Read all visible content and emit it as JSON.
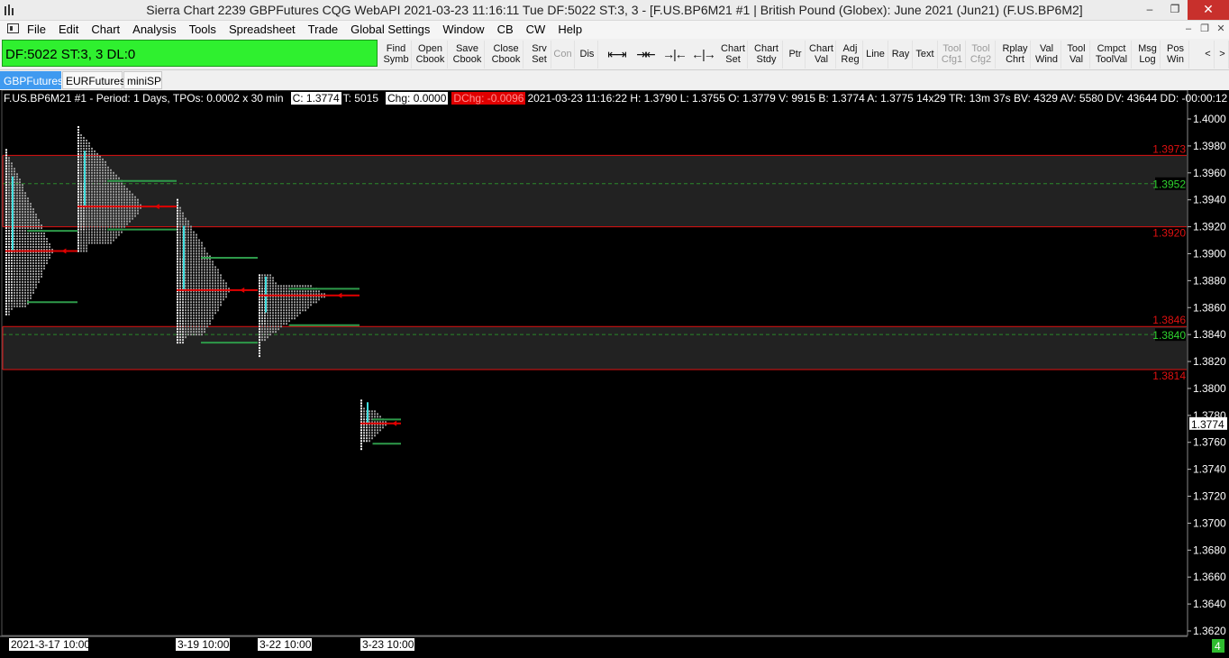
{
  "window": {
    "title": "Sierra Chart 2239 GBPFutures  CQG WebAPI 2021-03-23  11:16:11 Tue  DF:5022  ST:3, 3 - [F.US.BP6M21  #1 | British Pound (Globex): June 2021 (Jun21) (F.US.BP6M2]",
    "minimize": "–",
    "restore": "❐",
    "close": "✕"
  },
  "menu": {
    "items": [
      "File",
      "Edit",
      "Chart",
      "Analysis",
      "Tools",
      "Spreadsheet",
      "Trade",
      "Global Settings",
      "Window",
      "CB",
      "CW",
      "Help"
    ],
    "mdi_min": "–",
    "mdi_restore": "❐",
    "mdi_close": "✕"
  },
  "toolbar": {
    "status": "DF:5022  ST:3, 3  DL:0",
    "buttons": [
      {
        "l1": "Find",
        "l2": "Symb",
        "enabled": true
      },
      {
        "l1": "Open",
        "l2": "Cbook",
        "enabled": true
      },
      {
        "l1": "Save",
        "l2": "Cbook",
        "enabled": true
      },
      {
        "l1": "Close",
        "l2": "Cbook",
        "enabled": true
      },
      {
        "l1": "Srv",
        "l2": "Set",
        "enabled": true
      },
      {
        "l1": "Con",
        "l2": "",
        "enabled": false
      },
      {
        "l1": "Dis",
        "l2": "",
        "enabled": true
      }
    ],
    "icons": [
      "⇤⇥",
      "⇥⇤",
      "→|←",
      "←|→"
    ],
    "buttons2": [
      {
        "l1": "Chart",
        "l2": "Set",
        "enabled": true
      },
      {
        "l1": "Chart",
        "l2": "Stdy",
        "enabled": true
      },
      {
        "l1": "Ptr",
        "l2": "",
        "enabled": true
      },
      {
        "l1": "Chart",
        "l2": "Val",
        "enabled": true
      },
      {
        "l1": "Adj",
        "l2": "Reg",
        "enabled": true
      },
      {
        "l1": "Line",
        "l2": "",
        "enabled": true
      },
      {
        "l1": "Ray",
        "l2": "",
        "enabled": true
      },
      {
        "l1": "Text",
        "l2": "",
        "enabled": true
      },
      {
        "l1": "Tool",
        "l2": "Cfg1",
        "enabled": false
      },
      {
        "l1": "Tool",
        "l2": "Cfg2",
        "enabled": false
      },
      {
        "l1": "Rplay",
        "l2": "Chrt",
        "enabled": true
      },
      {
        "l1": "Val",
        "l2": "Wind",
        "enabled": true
      },
      {
        "l1": "Tool",
        "l2": "Val",
        "enabled": true
      },
      {
        "l1": "Cmpct",
        "l2": "ToolVal",
        "enabled": true
      },
      {
        "l1": "Msg",
        "l2": "Log",
        "enabled": true
      },
      {
        "l1": "Pos",
        "l2": "Win",
        "enabled": true
      }
    ],
    "scroll_left": "<",
    "scroll_right": ">"
  },
  "tabs": [
    {
      "label": "GBPFutures",
      "active": true
    },
    {
      "label": "EURFutures",
      "active": false
    },
    {
      "label": "miniSP",
      "active": false
    }
  ],
  "chart_info": {
    "symbol_period": "F.US.BP6M21  #1 - Period: 1 Days, TPOs: 0.0002 x 30 min",
    "close": "C: 1.3774",
    "trades": "T: 5015",
    "chg": "Chg: 0.0000",
    "dchg": "DChg: -0.0096",
    "rest": "2021-03-23 11:16:22 H: 1.3790 L: 1.3755 O: 1.3779 V: 9915 B: 1.3774 A: 1.3775 14x29 TR: 13m 37s BV: 4329 AV: 5580 DV: 43644 DD: -00:00:12"
  },
  "chart_data": {
    "type": "tpo-profile",
    "y_axis": {
      "min": 1.362,
      "max": 1.4,
      "ticks": [
        "1.4000",
        "1.3980",
        "1.3960",
        "1.3940",
        "1.3920",
        "1.3900",
        "1.3880",
        "1.3860",
        "1.3840",
        "1.3820",
        "1.3800",
        "1.3780",
        "1.3760",
        "1.3740",
        "1.3720",
        "1.3700",
        "1.3680",
        "1.3660",
        "1.3640",
        "1.3620"
      ]
    },
    "zones": [
      {
        "top": 1.3973,
        "bottom": 1.392,
        "top_label": "1.3973",
        "bottom_label": "1.3920",
        "mid": 1.3952,
        "mid_label": "1.3952"
      },
      {
        "top": 1.3846,
        "bottom": 1.3814,
        "top_label": "1.3846",
        "bottom_label": "1.3814",
        "mid": 1.384,
        "mid_label": "1.3840"
      }
    ],
    "current_price": {
      "value": 1.3774,
      "label": "1.3774"
    },
    "x_labels": [
      "2021-3-17  10:00",
      "3-19  10:00",
      "3-22  10:00",
      "3-23  10:00"
    ],
    "profiles": [
      {
        "high": 1.3978,
        "low": 1.3855,
        "poc": 1.3902,
        "vah": 1.3917,
        "val": 1.3864
      },
      {
        "high": 1.3994,
        "low": 1.3902,
        "poc": 1.3935,
        "vah": 1.3954,
        "val": 1.3918
      },
      {
        "high": 1.394,
        "low": 1.3834,
        "poc": 1.3873,
        "vah": 1.3897,
        "val": 1.3834
      },
      {
        "high": 1.3883,
        "low": 1.3824,
        "poc": 1.3869,
        "vah": 1.3874,
        "val": 1.3847
      },
      {
        "high": 1.379,
        "low": 1.3755,
        "poc": 1.3774,
        "vah": 1.3777,
        "val": 1.3759
      }
    ],
    "bottom_right_badge": "4"
  }
}
